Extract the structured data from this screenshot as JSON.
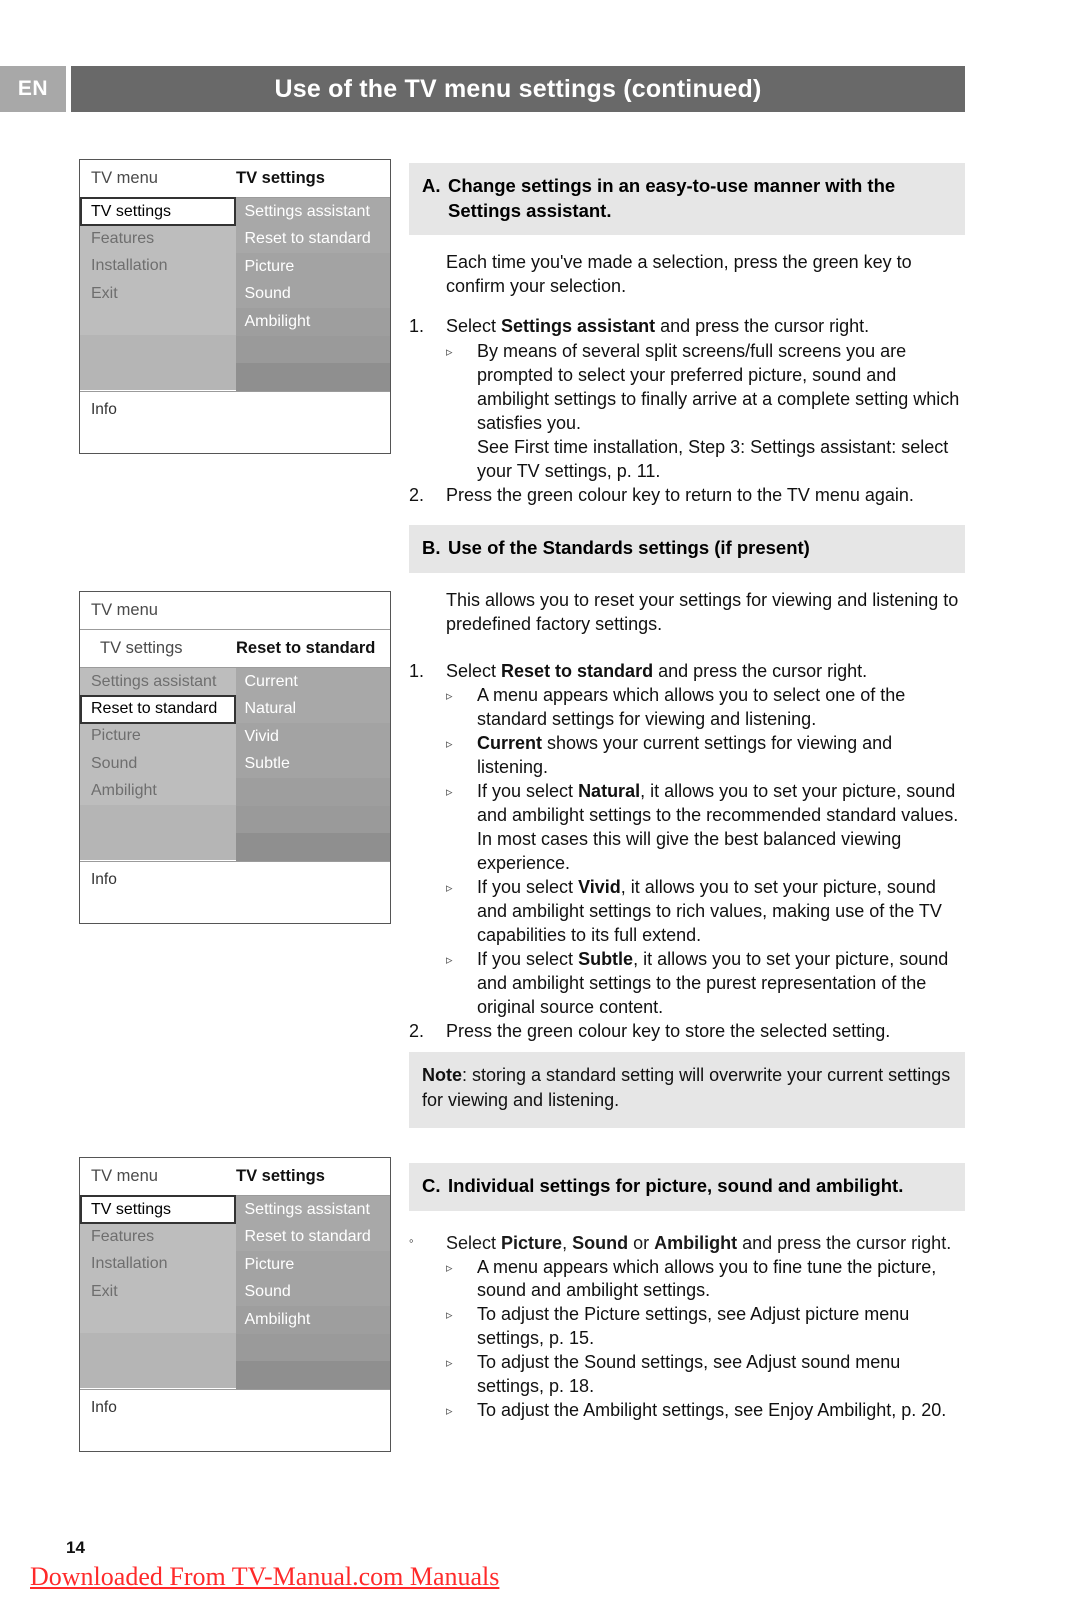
{
  "header": {
    "language_badge": "EN",
    "title": "Use of the TV menu settings (continued)"
  },
  "menu_screens": [
    {
      "id": "screen-a",
      "head_left": "TV menu",
      "head_right": "TV settings",
      "subhead_left": "",
      "subhead_right": "",
      "left_items": [
        "TV settings",
        "Features",
        "Installation",
        "Exit",
        "",
        "",
        ""
      ],
      "left_selected_index": 0,
      "right_items": [
        "Settings assistant",
        "Reset to standard",
        "Picture",
        "Sound",
        "Ambilight",
        "",
        ""
      ],
      "info_label": "Info"
    },
    {
      "id": "screen-b",
      "head_left": "TV menu",
      "head_right": "",
      "subhead_left": "TV settings",
      "subhead_right": "Reset to standard",
      "left_items": [
        "Settings assistant",
        "Reset to standard",
        "Picture",
        "Sound",
        "Ambilight",
        "",
        ""
      ],
      "left_selected_index": 1,
      "right_items": [
        "Current",
        "Natural",
        "Vivid",
        "Subtle",
        "",
        "",
        ""
      ],
      "info_label": "Info"
    },
    {
      "id": "screen-c",
      "head_left": "TV menu",
      "head_right": "TV settings",
      "subhead_left": "",
      "subhead_right": "",
      "left_items": [
        "TV settings",
        "Features",
        "Installation",
        "Exit",
        "",
        "",
        ""
      ],
      "left_selected_index": 0,
      "right_items": [
        "Settings assistant",
        "Reset to standard",
        "Picture",
        "Sound",
        "Ambilight",
        "",
        ""
      ],
      "info_label": "Info"
    }
  ],
  "section_a": {
    "letter": "A.",
    "heading_line1": "Change settings in an easy-to-use manner with the",
    "heading_line2": "Settings assistant.",
    "intro": "Each time you've made a selection, press the green key to confirm your selection.",
    "item1_num": "1.",
    "item1_pre": "Select ",
    "item1_bold": "Settings assistant",
    "item1_post": " and press the cursor right.",
    "sub1_text": "By means of several split screens/full screens you are prompted to select your preferred picture, sound and ambilight settings to finally arrive at a complete setting which satisfies you.",
    "sub1_text2": "See First time installation, Step 3: Settings assistant: select your TV settings, p. 11.",
    "item2_num": "2.",
    "item2_text": "Press the green colour key to return to the TV menu again."
  },
  "section_b": {
    "letter": "B.",
    "heading": "Use of the Standards settings (if present)",
    "intro": "This allows you to reset your settings for viewing and listening to predefined factory settings.",
    "item1_num": "1.",
    "item1_pre": "Select ",
    "item1_bold": "Reset to standard",
    "item1_post": " and press the cursor right.",
    "sub1": "A menu appears which allows you to select one of the standard settings for viewing and listening.",
    "sub2_bold": "Current",
    "sub2_post": " shows your current settings for viewing and listening.",
    "sub3_pre": "If you select ",
    "sub3_bold": "Natural",
    "sub3_post": ", it allows you to set your picture, sound and ambilight settings to the recommended standard values. In most cases this will give the best balanced viewing experience.",
    "sub4_pre": "If you select ",
    "sub4_bold": "Vivid",
    "sub4_post": ", it allows you to set your picture, sound and ambilight settings to rich values, making use of the TV capabilities to its full extend.",
    "sub5_pre": "If you select ",
    "sub5_bold": "Subtle",
    "sub5_post": ", it allows you to set your picture, sound and ambilight settings to the purest representation of the original source content.",
    "item2_num": "2.",
    "item2_text": "Press the green colour key to store the selected setting.",
    "note_bold": "Note",
    "note_text": ": storing a standard setting will overwrite your current settings for viewing and listening."
  },
  "section_c": {
    "letter": "C.",
    "heading": "Individual settings for picture, sound and ambilight.",
    "bullet": "◦",
    "item1_pre": "Select ",
    "item1_b1": "Picture",
    "item1_mid1": ", ",
    "item1_b2": "Sound",
    "item1_mid2": " or ",
    "item1_b3": "Ambilight",
    "item1_post": " and press the cursor right.",
    "sub1": "A menu appears which allows you to fine tune the picture, sound and ambilight settings.",
    "sub2": "To adjust the Picture settings, see Adjust picture menu settings, p. 15.",
    "sub3": "To adjust the Sound settings, see Adjust sound menu settings, p. 18.",
    "sub4": "To adjust the Ambilight settings, see Enjoy Ambilight, p. 20."
  },
  "footer": {
    "page_number": "14",
    "watermark": "Downloaded From TV-Manual.com Manuals"
  },
  "icons": {
    "triangle_bullet": "▹",
    "circle_bullet": "◦"
  },
  "colors": {
    "header_bar": "#696969",
    "lang_badge": "#a8a8a8",
    "section_heading_bg": "#e6e6e6",
    "menu_left_row": "#bdbdbd",
    "menu_right_row": "#a3a3a3",
    "watermark_red": "#ff2a2a"
  }
}
